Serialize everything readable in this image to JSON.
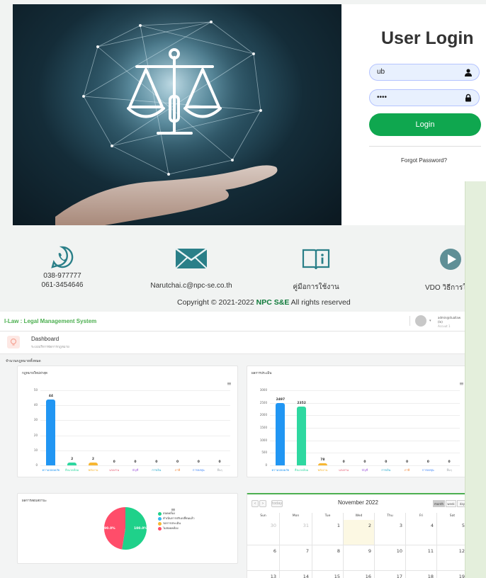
{
  "login": {
    "title": "User Login",
    "username_value": "ub",
    "password_value": "••••",
    "login_label": "Login",
    "forgot_label": "Forgot Password?"
  },
  "contact": {
    "phone1": "038-977777",
    "phone2": "061-3454646",
    "email": "Narutchai.c@npc-se.co.th",
    "manual": "คู่มือการใช้งาน",
    "video": "VDO วิธีการใช้",
    "copyright_prefix": "Copyright © 2021-2022 ",
    "copyright_brand": "NPC S&E",
    "copyright_suffix": " All rights reserved"
  },
  "dashboard": {
    "brand": "I-Law : Legal Management System",
    "user_line1": "admin@ituallaw (In)",
    "user_line2": "Accuut 1",
    "page_title": "Dashboard",
    "page_subtitle": "ระบบบริหารจัดการกฎหมาย",
    "section_label": "จำนวนกฎหมายทั้งหมด"
  },
  "chart_data": [
    {
      "type": "bar",
      "title": "กฎหมายใหม่ล่าสุด",
      "categories": [
        "ความปลอดภัย",
        "สิ่งแวดล้อม",
        "พลังงาน",
        "แรงงาน",
        "บัญชี",
        "การเงิน",
        "ภาษี",
        "การลงทุน",
        "อื่นๆ"
      ],
      "values": [
        44,
        2,
        2,
        0,
        0,
        0,
        0,
        0,
        0
      ],
      "yticks": [
        "0",
        "10",
        "20",
        "30",
        "40",
        "50"
      ],
      "ylim": [
        0,
        50
      ],
      "colors": [
        "#2196f3",
        "#2ed8a0",
        "#f7b733",
        "#555555",
        "#555555",
        "#555555",
        "#555555",
        "#555555",
        "#555555"
      ]
    },
    {
      "type": "bar",
      "title": "ผลการประเมิน",
      "categories": [
        "ความปลอดภัย",
        "สิ่งแวดล้อม",
        "พลังงาน",
        "แรงงาน",
        "บัญชี",
        "การเงิน",
        "ภาษี",
        "การลงทุน",
        "อื่นๆ"
      ],
      "values": [
        2497,
        2352,
        78,
        0,
        0,
        0,
        0,
        0,
        0
      ],
      "yticks": [
        "0",
        "500",
        "1000",
        "1500",
        "2000",
        "2500",
        "3000"
      ],
      "ylim": [
        0,
        3000
      ],
      "colors": [
        "#2196f3",
        "#2ed8a0",
        "#f7b733",
        "#555555",
        "#555555",
        "#555555",
        "#555555",
        "#555555",
        "#555555"
      ]
    },
    {
      "type": "pie",
      "title": "ผลการสอบสถานะ",
      "labels": [
        "สอดคล้อง",
        "ดำเนินการปรับเปลี่ยนแล้ว",
        "รอการประเมิน",
        "ไม่สอดคล้อง"
      ],
      "values": [
        100,
        0,
        0,
        90
      ],
      "slice_labels": [
        "100.0%",
        "90.0%"
      ],
      "colors": [
        "#1fd18a",
        "#35b6f2",
        "#f7b733",
        "#ff4d6a"
      ]
    }
  ],
  "cat_colors": [
    "#2196f3",
    "#2ed8a0",
    "#f7b733",
    "#e6506a",
    "#a25ddc",
    "#1fa6c9",
    "#f07f2a",
    "#3b82f6",
    "#9aa0a6"
  ],
  "calendar": {
    "month_title": "November 2022",
    "today_label": "today",
    "views": [
      "month",
      "week",
      "day"
    ],
    "weekdays": [
      "Sun",
      "Mon",
      "Tue",
      "Wed",
      "Thu",
      "Fri",
      "Sat"
    ],
    "rows": [
      [
        "30",
        "31",
        "1",
        "2",
        "3",
        "4",
        "5"
      ],
      [
        "6",
        "7",
        "8",
        "9",
        "10",
        "11",
        "12"
      ],
      [
        "13",
        "14",
        "15",
        "16",
        "17",
        "18",
        "19"
      ]
    ]
  }
}
